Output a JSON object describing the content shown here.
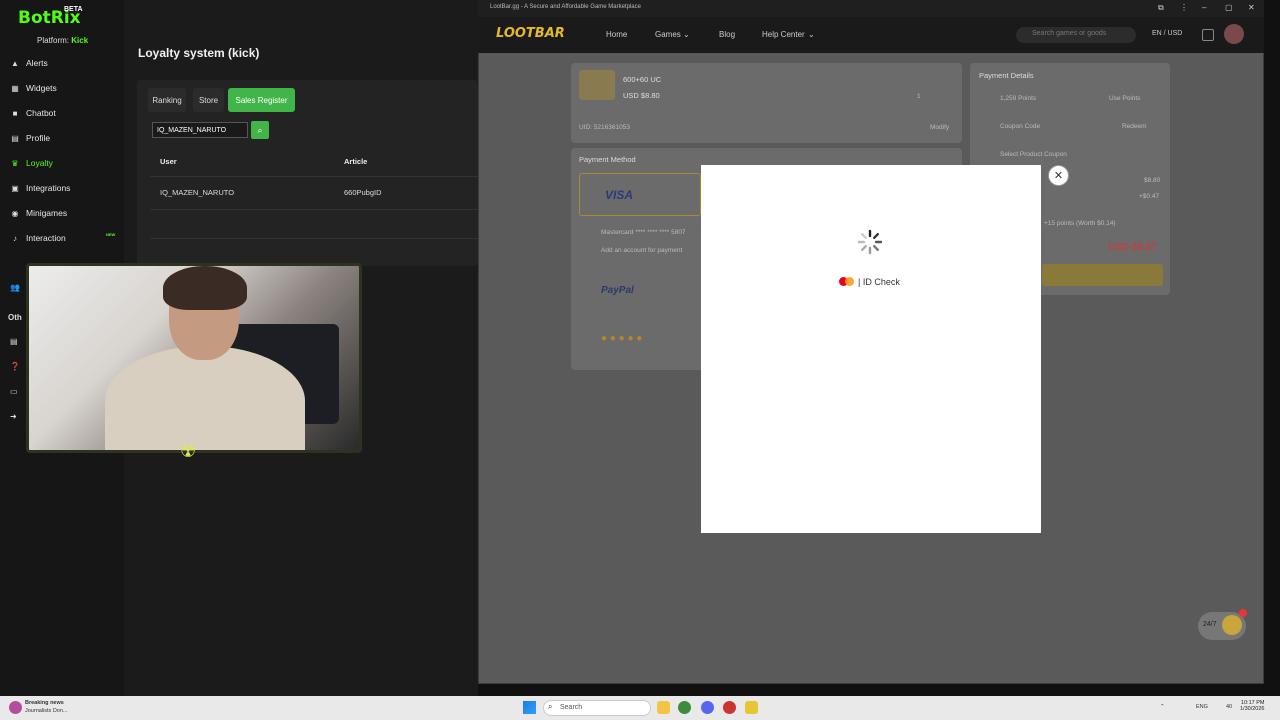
{
  "botrix": {
    "logo": "BotRix",
    "beta": "BETA",
    "platform_label": "Platform:",
    "platform_value": "Kick",
    "nav": [
      {
        "label": "Alerts",
        "icon": "warning-icon"
      },
      {
        "label": "Widgets",
        "icon": "grid-icon"
      },
      {
        "label": "Chatbot",
        "icon": "robot-icon"
      },
      {
        "label": "Profile",
        "icon": "id-card-icon"
      },
      {
        "label": "Loyalty",
        "icon": "trophy-icon"
      },
      {
        "label": "Integrations",
        "icon": "integrations-icon"
      },
      {
        "label": "Minigames",
        "icon": "gamepad-icon"
      },
      {
        "label": "Interaction",
        "icon": "music-icon"
      }
    ],
    "new_badge": "NEW",
    "section_other": "Oth",
    "page_title": "Loyalty system (kick)",
    "tabs": [
      "Ranking",
      "Store",
      "Sales Register"
    ],
    "search_value": "IQ_MAZEN_NARUTO",
    "table": {
      "headers": [
        "User",
        "Article"
      ],
      "rows": [
        [
          "IQ_MAZEN_NARUTO",
          "660PubgID"
        ]
      ]
    }
  },
  "browser": {
    "tab_title": "LootBar.gg - A Secure and Affordable Game Marketplace",
    "site_logo": "LOOTBAR",
    "nav": [
      "Home",
      "Games",
      "Blog",
      "Help Center"
    ],
    "search_placeholder": "Search games or goods",
    "lang": "EN / USD",
    "product": {
      "name": "600+60 UC",
      "price": "USD $8.80",
      "qty": "1",
      "uid": "UID: 5216361053",
      "modify": "Modify"
    },
    "payment_method_title": "Payment Method",
    "visa": "VISA",
    "mastercard_line": "Mastercard **** **** **** 5807",
    "add_account": "Add an account for payment",
    "paypal": "PayPal",
    "details": {
      "title": "Payment Details",
      "points": "1,259 Points",
      "use_points": "Use Points",
      "coupon": "Coupon Code",
      "redeem": "Redeem",
      "product_coupon": "Select Product Coupon",
      "subtotal": "$8.80",
      "fee": "+$0.47",
      "points_note": "+15 points (Worth $0.14)",
      "total": "USD $8.37"
    },
    "modal": {
      "brand": "ID Check"
    },
    "chat": "24/7"
  },
  "taskbar": {
    "news_title": "Breaking news",
    "news_sub": "Journalists Don...",
    "search": "Search",
    "time": "10:17 PM",
    "date": "1/30/2026",
    "lang": "ENG",
    "vol": "40"
  },
  "colors": {
    "kick_green": "#53fc18",
    "button_green": "#42b549",
    "loot_gold": "#e5b92b"
  }
}
